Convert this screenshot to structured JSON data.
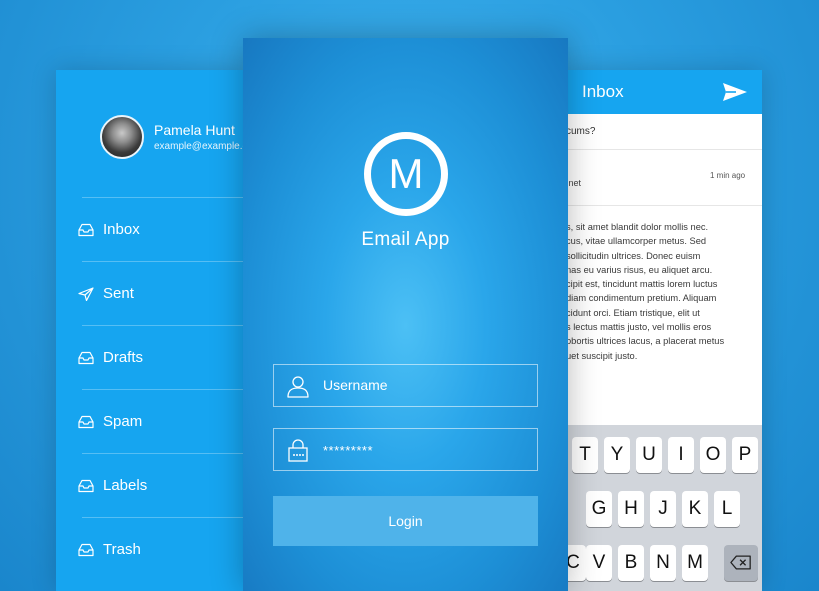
{
  "sidebar": {
    "profile": {
      "name": "Pamela Hunt",
      "email": "example@example.com"
    },
    "items": [
      {
        "label": "Inbox",
        "icon": "inbox-tray-icon"
      },
      {
        "label": "Sent",
        "icon": "paper-plane-icon"
      },
      {
        "label": "Drafts",
        "icon": "drafts-tray-icon"
      },
      {
        "label": "Spam",
        "icon": "spam-tray-icon"
      },
      {
        "label": "Labels",
        "icon": "labels-tray-icon"
      },
      {
        "label": "Trash",
        "icon": "trash-tray-icon"
      }
    ]
  },
  "login": {
    "logo_letter": "M",
    "app_name": "Email App",
    "username_placeholder": "Username",
    "password_value": "*********",
    "login_label": "Login"
  },
  "inbox": {
    "title": "Inbox",
    "search_text": "cums?",
    "email": {
      "from_fragment": ".net",
      "time": "1 min ago"
    },
    "body_lines": [
      "s, sit amet blandit dolor mollis nec.",
      "cus, vitae ullamcorper metus. Sed",
      " sollicitudin ultrices. Donec euism",
      "nas eu varius risus, eu aliquet arcu.",
      "cipit est, tincidunt mattis lorem luctus",
      "diam condimentum pretium. Aliquam",
      "cidunt orci. Etiam tristique, elit ut",
      "s lectus mattis justo, vel mollis eros",
      "obortis ultrices lacus, a placerat metus",
      "uet suscipit justo."
    ],
    "keyboard": {
      "row1": [
        "T",
        "Y",
        "U",
        "I",
        "O",
        "P"
      ],
      "row2": [
        "G",
        "H",
        "J",
        "K",
        "L"
      ],
      "row3": [
        "C",
        "V",
        "B",
        "N",
        "M"
      ]
    }
  },
  "colors": {
    "background": "#2a9ee0",
    "sidebar": "#16a5f0",
    "login_button": "#4fb3ea",
    "keyboard_bg": "#d1d5db",
    "text_white": "#ffffff"
  }
}
